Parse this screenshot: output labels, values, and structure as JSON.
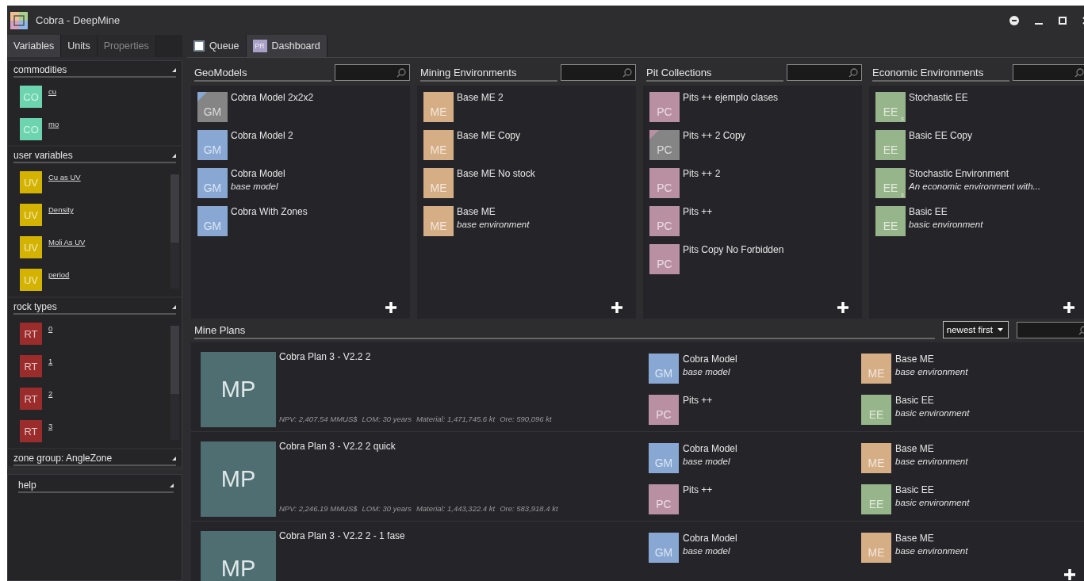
{
  "window": {
    "title": "Cobra -  DeepMine"
  },
  "sidebar": {
    "tabs": [
      {
        "label": "Variables",
        "selected": true,
        "disabled": false
      },
      {
        "label": "Units",
        "selected": false,
        "disabled": false
      },
      {
        "label": "Properties",
        "selected": false,
        "disabled": true
      }
    ],
    "sections": [
      {
        "title": "commodities",
        "scrollable": false,
        "items": [
          {
            "badge": "CO",
            "color": "#6dd4b0",
            "label": "cu"
          },
          {
            "badge": "CO",
            "color": "#6dd4b0",
            "label": "mo"
          }
        ]
      },
      {
        "title": "user variables",
        "scrollable": true,
        "items": [
          {
            "badge": "UV",
            "color": "#d4b300",
            "label": "Cu as UV"
          },
          {
            "badge": "UV",
            "color": "#d4b300",
            "label": "Density"
          },
          {
            "badge": "UV",
            "color": "#d4b300",
            "label": "Moli As UV"
          },
          {
            "badge": "UV",
            "color": "#d4b300",
            "label": "period"
          }
        ]
      },
      {
        "title": "rock types",
        "scrollable": true,
        "items": [
          {
            "badge": "RT",
            "color": "#9b2c2c",
            "label": "0"
          },
          {
            "badge": "RT",
            "color": "#9b2c2c",
            "label": "1"
          },
          {
            "badge": "RT",
            "color": "#9b2c2c",
            "label": "2"
          },
          {
            "badge": "RT",
            "color": "#9b2c2c",
            "label": "3"
          }
        ]
      },
      {
        "title": "zone group: AngleZone"
      }
    ],
    "help": {
      "title": "help"
    }
  },
  "main_tabs": [
    {
      "label": "Queue",
      "kind": "checkbox",
      "selected": false
    },
    {
      "label": "Dashboard",
      "kind": "badge",
      "icon_text": "PR",
      "selected": true
    }
  ],
  "panels": [
    {
      "title": "GeoModels",
      "items": [
        {
          "badge": "GM",
          "color": "#858585",
          "name": "Cobra Model 2x2x2",
          "corner": true
        },
        {
          "badge": "GM",
          "color": "#88a8d3",
          "name": "Cobra Model 2",
          "corner": false
        },
        {
          "badge": "GM",
          "color": "#88a8d3",
          "name": "Cobra Model",
          "desc": "base model",
          "corner": false
        },
        {
          "badge": "GM",
          "color": "#88a8d3",
          "name": "Cobra With Zones",
          "corner": false
        }
      ]
    },
    {
      "title": "Mining Environments",
      "items": [
        {
          "badge": "ME",
          "color": "#d5ae86",
          "name": "Base ME 2",
          "corner": false
        },
        {
          "badge": "ME",
          "color": "#d5ae86",
          "name": "Base ME Copy",
          "corner": false
        },
        {
          "badge": "ME",
          "color": "#d5ae86",
          "name": "Base ME No stock",
          "corner": false
        },
        {
          "badge": "ME",
          "color": "#d5ae86",
          "name": "Base ME",
          "desc": "base environment",
          "corner": false
        }
      ]
    },
    {
      "title": "Pit Collections",
      "items": [
        {
          "badge": "PC",
          "color": "#b990a2",
          "name": "Pits ++ ejemplo clases",
          "corner": false
        },
        {
          "badge": "PC",
          "color": "#858585",
          "name": "Pits ++ 2 Copy",
          "corner": true
        },
        {
          "badge": "PC",
          "color": "#b990a2",
          "name": "Pits ++ 2",
          "corner": false
        },
        {
          "badge": "PC",
          "color": "#b990a2",
          "name": "Pits ++",
          "corner": false
        },
        {
          "badge": "PC",
          "color": "#b990a2",
          "name": "Pits Copy No Forbidden",
          "corner": false
        }
      ]
    },
    {
      "title": "Economic Environments",
      "items": [
        {
          "badge": "EE",
          "color": "#97b58a",
          "name": "Stochastic EE",
          "mark": "s",
          "corner": false
        },
        {
          "badge": "EE",
          "color": "#97b58a",
          "name": "Basic EE Copy",
          "corner": false
        },
        {
          "badge": "EE",
          "color": "#97b58a",
          "name": "Stochastic Environment",
          "desc": "An economic environment with...",
          "mark": "s",
          "corner": false
        },
        {
          "badge": "EE",
          "color": "#97b58a",
          "name": "Basic EE",
          "desc": "basic environment",
          "corner": false
        }
      ]
    }
  ],
  "mine_plans": {
    "title": "Mine Plans",
    "sort": "newest first",
    "plans": [
      {
        "title": "Cobra Plan 3 - V2.2 2",
        "badge": "MP",
        "stats": [
          "NPV: 2,407.54 MMUS$",
          "LOM: 30 years",
          "Material: 1,471,745.6 kt",
          "Ore: 590,096 kt"
        ],
        "links": [
          {
            "badge": "GM",
            "color": "#88a8d3",
            "name": "Cobra Model",
            "desc": "base model"
          },
          {
            "badge": "ME",
            "color": "#d5ae86",
            "name": "Base ME",
            "desc": "base environment"
          },
          {
            "badge": "PC",
            "color": "#b990a2",
            "name": "Pits ++"
          },
          {
            "badge": "EE",
            "color": "#97b58a",
            "name": "Basic EE",
            "desc": "basic environment"
          }
        ]
      },
      {
        "title": "Cobra Plan 3 - V2.2 2 quick",
        "badge": "MP",
        "stats": [
          "NPV: 2,246.19 MMUS$",
          "LOM: 30 years",
          "Material: 1,443,322.4 kt",
          "Ore: 583,918.4 kt"
        ],
        "links": [
          {
            "badge": "GM",
            "color": "#88a8d3",
            "name": "Cobra Model",
            "desc": "base model"
          },
          {
            "badge": "ME",
            "color": "#d5ae86",
            "name": "Base ME",
            "desc": "base environment"
          },
          {
            "badge": "PC",
            "color": "#b990a2",
            "name": "Pits ++"
          },
          {
            "badge": "EE",
            "color": "#97b58a",
            "name": "Basic EE",
            "desc": "basic environment"
          }
        ]
      },
      {
        "title": "Cobra Plan 3 - V2.2 2 - 1 fase",
        "badge": "MP",
        "links": [
          {
            "badge": "GM",
            "color": "#88a8d3",
            "name": "Cobra Model",
            "desc": "base model"
          },
          {
            "badge": "ME",
            "color": "#d5ae86",
            "name": "Base ME",
            "desc": "base environment"
          }
        ]
      }
    ]
  }
}
